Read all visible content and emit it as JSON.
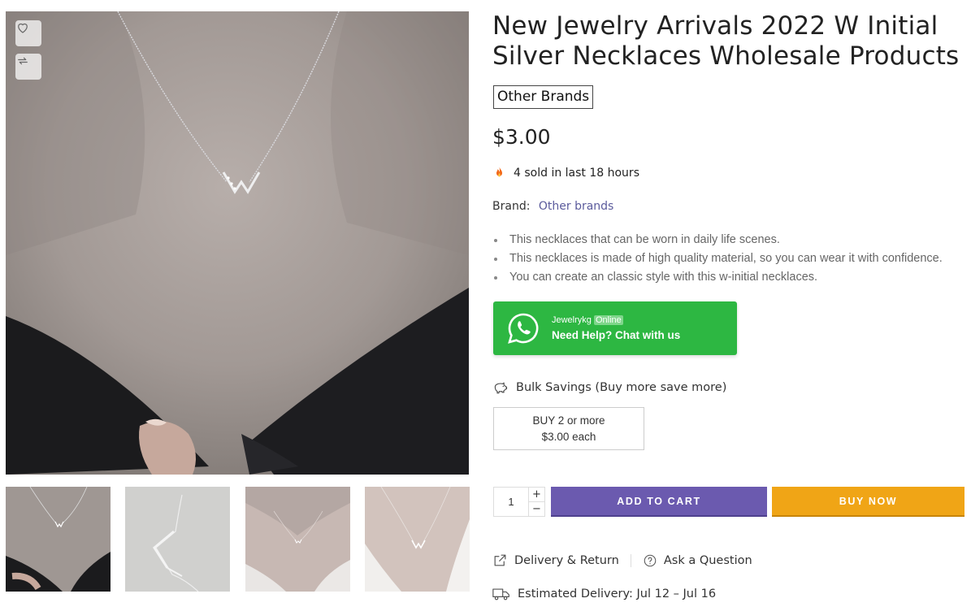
{
  "product": {
    "title_line1": "New Jewelry Arrivals 2022 W Initial",
    "title_line2": "Silver Necklaces Wholesale Products",
    "brand_tag": "Other Brands",
    "price": "$3.00",
    "sold_text": "4 sold in last 18 hours",
    "brand_label": "Brand:",
    "brand_value": "Other brands",
    "bullets": [
      "This necklaces that can be worn in daily life scenes.",
      "This necklaces is made of high quality material, so you can wear it with confidence.",
      "You can create an classic style with this w-initial necklaces."
    ]
  },
  "gallery": {
    "wishlist_icon": "heart-icon",
    "compare_icon": "compare-arrows-icon",
    "thumbnail_count": 4
  },
  "whatsapp": {
    "name": "Jewelrykg",
    "status": "Online",
    "cta": "Need Help? Chat with us",
    "color": "#2db742"
  },
  "bulk": {
    "heading": "Bulk Savings (Buy more save more)",
    "tier_line1": "BUY 2 or more",
    "tier_line2": "$3.00 each"
  },
  "purchase": {
    "quantity": "1",
    "plus": "+",
    "minus": "−",
    "add_to_cart": "ADD TO CART",
    "buy_now": "BUY NOW",
    "cart_color": "#6b5aaf",
    "buy_color": "#f0a516"
  },
  "links": {
    "delivery_return": "Delivery & Return",
    "ask_question": "Ask a Question"
  },
  "delivery": {
    "estimate": "Estimated Delivery: Jul 12 – Jul 16"
  }
}
